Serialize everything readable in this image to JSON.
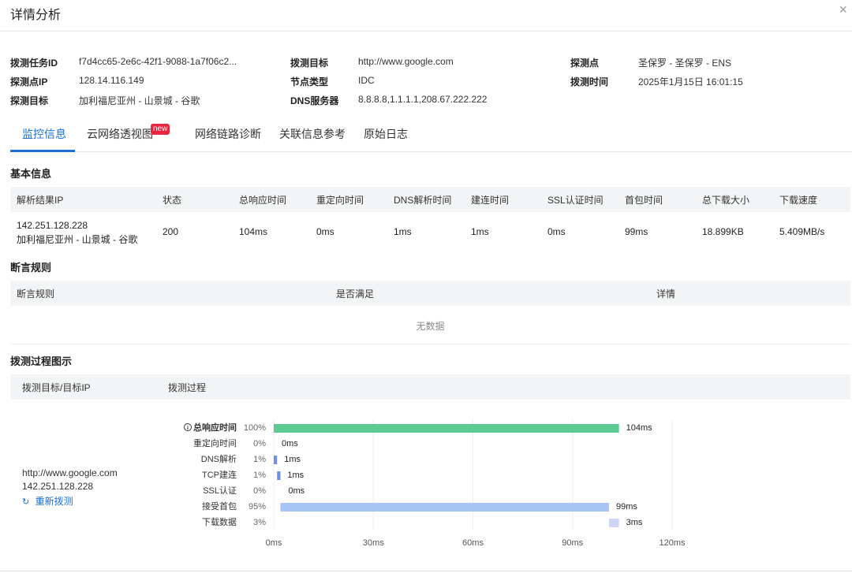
{
  "dialog": {
    "title": "详情分析",
    "close_icon": "×"
  },
  "task_info": {
    "col1": [
      {
        "label": "拨测任务ID",
        "value": "f7d4cc65-2e6c-42f1-9088-1a7f06c2..."
      },
      {
        "label": "探测点IP",
        "value": "128.14.116.149"
      },
      {
        "label": "探测目标",
        "value": "加利福尼亚州 - 山景城 - 谷歌"
      }
    ],
    "col2": [
      {
        "label": "拨测目标",
        "value": "http://www.google.com"
      },
      {
        "label": "节点类型",
        "value": "IDC"
      },
      {
        "label": "DNS服务器",
        "value": "8.8.8.8,1.1.1.1,208.67.222.222"
      }
    ],
    "col3": [
      {
        "label": "探测点",
        "value": "圣保罗 - 圣保罗 - ENS"
      },
      {
        "label": "拨测时间",
        "value": "2025年1月15日 16:01:15"
      }
    ]
  },
  "tabs": [
    {
      "label": "监控信息",
      "active": true
    },
    {
      "label": "云网络透视图",
      "badge": "new"
    },
    {
      "label": "网络链路诊断"
    },
    {
      "label": "关联信息参考"
    },
    {
      "label": "原始日志"
    }
  ],
  "basic_info": {
    "title": "基本信息",
    "headers": [
      "解析结果IP",
      "状态",
      "总响应时间",
      "重定向时间",
      "DNS解析时间",
      "建连时间",
      "SSL认证时间",
      "首包时间",
      "总下载大小",
      "下载速度"
    ],
    "row": {
      "ip": "142.251.128.228",
      "location": "加利福尼亚州 - 山景城 - 谷歌",
      "cells": [
        "200",
        "104ms",
        "0ms",
        "1ms",
        "1ms",
        "0ms",
        "99ms",
        "18.899KB",
        "5.409MB/s"
      ]
    }
  },
  "assertion": {
    "title": "断言规则",
    "headers": [
      "断言规则",
      "是否满足",
      "详情"
    ],
    "empty_text": "无数据"
  },
  "process": {
    "title": "拨测过程图示",
    "headers": [
      "拨测目标/目标IP",
      "拨测过程"
    ],
    "target_url": "http://www.google.com",
    "target_ip": "142.251.128.228",
    "retry_label": "重新拨测"
  },
  "chart_data": {
    "type": "bar",
    "orientation": "horizontal-waterfall",
    "categories": [
      "总响应时间",
      "重定向时间",
      "DNS解析",
      "TCP建连",
      "SSL认证",
      "接受首包",
      "下载数据"
    ],
    "percents": [
      "100%",
      "0%",
      "1%",
      "1%",
      "0%",
      "95%",
      "3%"
    ],
    "values_ms": [
      104,
      0,
      1,
      1,
      0,
      99,
      3
    ],
    "start_ms": [
      0,
      0,
      0,
      1,
      2,
      2,
      101
    ],
    "labels": [
      "104ms",
      "0ms",
      "1ms",
      "1ms",
      "0ms",
      "99ms",
      "3ms"
    ],
    "colors": [
      "#5ccb91",
      "#6f8fe8",
      "#6f8fe8",
      "#6f8fe8",
      "#6f8fe8",
      "#a8c4f5",
      "#cfd4f5"
    ],
    "xticks": [
      0,
      30,
      60,
      90,
      120
    ],
    "xtick_labels": [
      "0ms",
      "30ms",
      "60ms",
      "90ms",
      "120ms"
    ],
    "xlim": [
      0,
      120
    ]
  }
}
